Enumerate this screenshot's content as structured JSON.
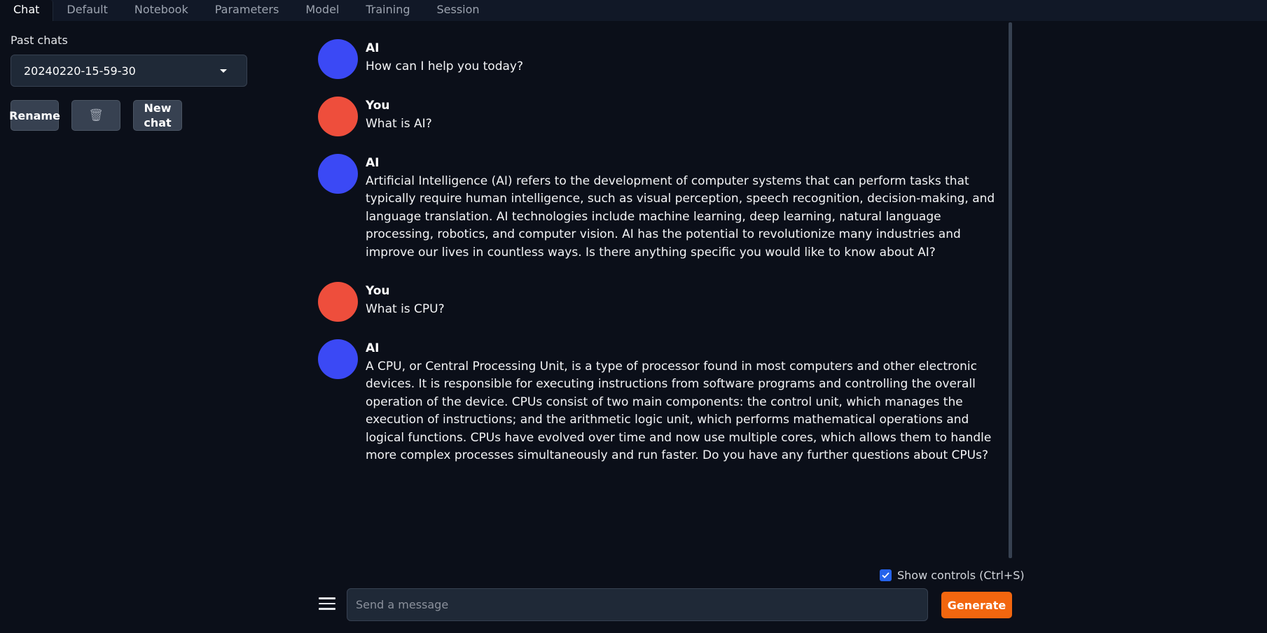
{
  "tabs": [
    {
      "label": "Chat"
    },
    {
      "label": "Default"
    },
    {
      "label": "Notebook"
    },
    {
      "label": "Parameters"
    },
    {
      "label": "Model"
    },
    {
      "label": "Training"
    },
    {
      "label": "Session"
    }
  ],
  "sidebar": {
    "past_chats_label": "Past chats",
    "selected_chat": "20240220-15-59-30",
    "rename_label": "Rename",
    "delete_icon": "🗑",
    "new_chat_label": "New chat"
  },
  "messages": [
    {
      "sender": "AI",
      "text": "How can I help you today?"
    },
    {
      "sender": "You",
      "text": "What is AI?"
    },
    {
      "sender": "AI",
      "text": "Artificial Intelligence (AI) refers to the development of computer systems that can perform tasks that typically require human intelligence, such as visual perception, speech recognition, decision-making, and language translation. AI technologies include machine learning, deep learning, natural language processing, robotics, and computer vision. AI has the potential to revolutionize many industries and improve our lives in countless ways. Is there anything specific you would like to know about AI?"
    },
    {
      "sender": "You",
      "text": "What is CPU?"
    },
    {
      "sender": "AI",
      "text": "A CPU, or Central Processing Unit, is a type of processor found in most computers and other electronic devices. It is responsible for executing instructions from software programs and controlling the overall operation of the device. CPUs consist of two main components: the control unit, which manages the execution of instructions; and the arithmetic logic unit, which performs mathematical operations and logical functions. CPUs have evolved over time and now use multiple cores, which allows them to handle more complex processes simultaneously and run faster. Do you have any further questions about CPUs?"
    }
  ],
  "controls": {
    "show_controls_label": "Show controls (Ctrl+S)",
    "show_controls_checked": true,
    "input_placeholder": "Send a message",
    "input_value": "",
    "generate_label": "Generate"
  },
  "colors": {
    "background": "#0b0f19",
    "ai_avatar": "#3b49f5",
    "user_avatar": "#ee4e3c",
    "accent": "#f2660f",
    "checkbox": "#2563eb"
  }
}
